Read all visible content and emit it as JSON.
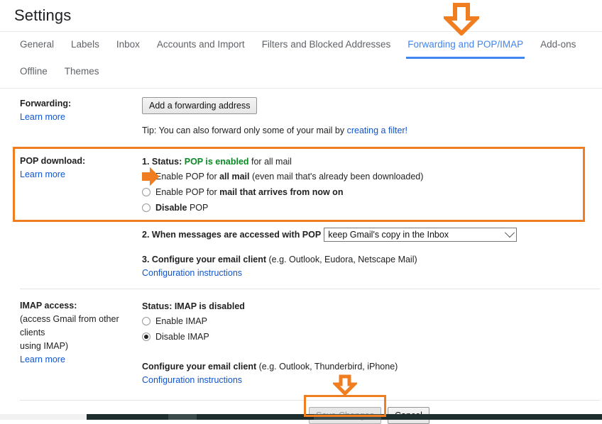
{
  "header": {
    "title": "Settings"
  },
  "tabs": [
    {
      "label": "General",
      "active": false
    },
    {
      "label": "Labels",
      "active": false
    },
    {
      "label": "Inbox",
      "active": false
    },
    {
      "label": "Accounts and Import",
      "active": false
    },
    {
      "label": "Filters and Blocked Addresses",
      "active": false
    },
    {
      "label": "Forwarding and POP/IMAP",
      "active": true
    },
    {
      "label": "Add-ons",
      "active": false
    },
    {
      "label": "Offline",
      "active": false
    },
    {
      "label": "Themes",
      "active": false
    }
  ],
  "forwarding": {
    "label": "Forwarding:",
    "learn_more": "Learn more",
    "add_button": "Add a forwarding address",
    "tip_prefix": "Tip: You can also forward only some of your mail by ",
    "tip_link": "creating a filter!"
  },
  "pop": {
    "label": "POP download:",
    "learn_more": "Learn more",
    "status_number": "1. Status: ",
    "status_value": "POP is enabled",
    "status_suffix": " for all mail",
    "options": [
      {
        "prefix": "Enable POP for ",
        "bold": "all mail",
        "suffix": " (even mail that's already been downloaded)",
        "checked": false,
        "hover": true
      },
      {
        "prefix": "Enable POP for ",
        "bold": "mail that arrives from now on",
        "suffix": "",
        "checked": false,
        "hover": false
      },
      {
        "prefix": "",
        "bold": "Disable",
        "suffix": " POP",
        "checked": false,
        "hover": false
      }
    ],
    "step2_label": "2. When messages are accessed with POP",
    "step2_select_value": "keep Gmail's copy in the Inbox",
    "step3_bold": "3. Configure your email client",
    "step3_rest": " (e.g. Outlook, Eudora, Netscape Mail)",
    "step3_link": "Configuration instructions"
  },
  "imap": {
    "label": "IMAP access:",
    "sublabel_line1": "(access Gmail from other clients",
    "sublabel_line2": "using IMAP)",
    "learn_more": "Learn more",
    "status": "Status: IMAP is disabled",
    "options": [
      {
        "label": "Enable IMAP",
        "checked": false
      },
      {
        "label": "Disable IMAP",
        "checked": true
      }
    ],
    "configure_bold": "Configure your email client",
    "configure_rest": " (e.g. Outlook, Thunderbird, iPhone)",
    "configure_link": "Configuration instructions"
  },
  "footer": {
    "save_label": "Save Changes",
    "save_disabled": true,
    "cancel_label": "Cancel"
  },
  "annotations": {
    "arrow_color": "#f07d20",
    "highlight_color": "#f07d20",
    "tab_arrow_name": "down-arrow-icon",
    "radio_arrow_name": "right-arrow-icon",
    "save_arrow_name": "down-arrow-icon"
  },
  "colors": {
    "accent_blue": "#4285f4",
    "link_blue": "#1155cc",
    "status_green": "#0a8a24",
    "orange": "#f07d20",
    "taskbar": "#1e2e2e"
  }
}
